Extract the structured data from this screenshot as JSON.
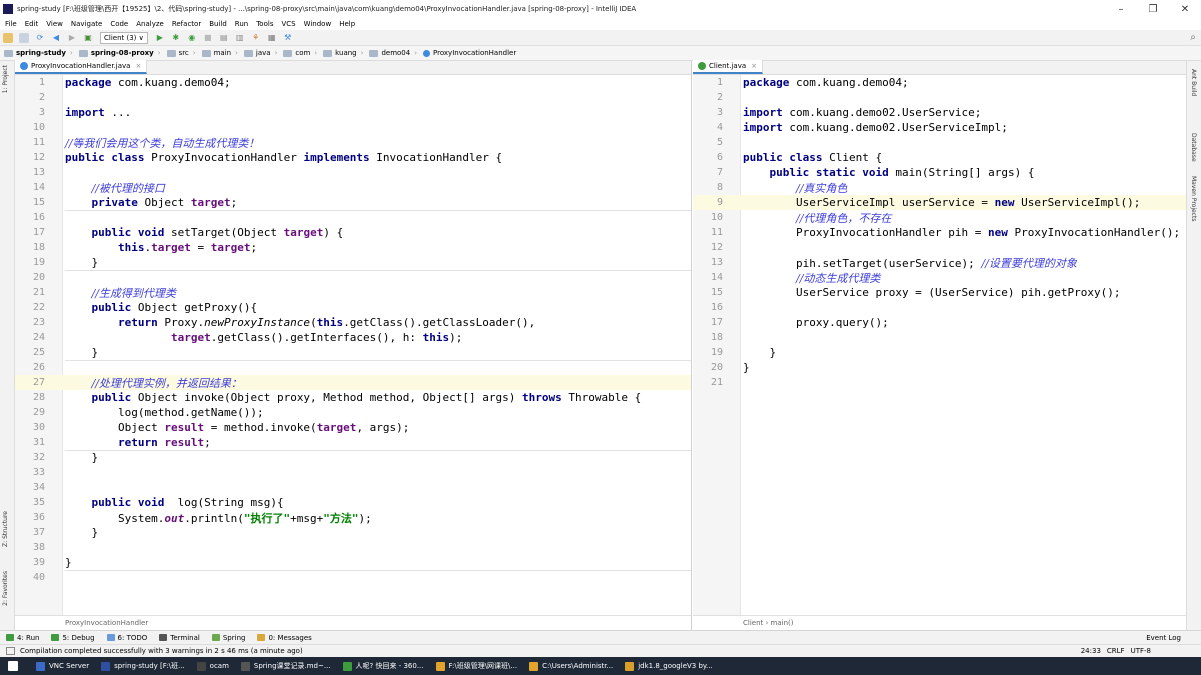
{
  "window": {
    "title": "spring-study [F:\\班级管理\\西开【19525】\\2、代码\\spring-study] - ...\\spring-08-proxy\\src\\main\\java\\com\\kuang\\demo04\\ProxyInvocationHandler.java [spring-08-proxy] - IntelliJ IDEA",
    "minimize": "–",
    "maximize": "❐",
    "close": "✕"
  },
  "menu": [
    "File",
    "Edit",
    "View",
    "Navigate",
    "Code",
    "Analyze",
    "Refactor",
    "Build",
    "Run",
    "Tools",
    "VCS",
    "Window",
    "Help"
  ],
  "toolbar": {
    "run_config": "Client (3) ∨"
  },
  "breadcrumb": [
    "spring-study",
    "spring-08-proxy",
    "src",
    "main",
    "java",
    "com",
    "kuang",
    "demo04",
    "ProxyInvocationHandler"
  ],
  "left_side_tabs": {
    "project": "1: Project",
    "structure": "Z: Structure",
    "favorites": "2: Favorites"
  },
  "right_side_tabs": {
    "ant": "Ant Build",
    "database": "Database",
    "maven": "Maven Projects"
  },
  "left_editor": {
    "tab": "ProxyInvocationHandler.java",
    "footer": "ProxyInvocationHandler",
    "lines": [
      {
        "n": "1",
        "t": "package com.kuang.demo04;"
      },
      {
        "n": "2",
        "t": ""
      },
      {
        "n": "3",
        "t": "import ..."
      },
      {
        "n": "10",
        "t": ""
      },
      {
        "n": "11",
        "t": "//等我们会用这个类，自动生成代理类！"
      },
      {
        "n": "12",
        "t": "public class ProxyInvocationHandler implements InvocationHandler {"
      },
      {
        "n": "13",
        "t": ""
      },
      {
        "n": "14",
        "t": "    //被代理的接口"
      },
      {
        "n": "15",
        "t": "    private Object target;"
      },
      {
        "n": "16",
        "t": ""
      },
      {
        "n": "17",
        "t": "    public void setTarget(Object target) {"
      },
      {
        "n": "18",
        "t": "        this.target = target;"
      },
      {
        "n": "19",
        "t": "    }"
      },
      {
        "n": "20",
        "t": ""
      },
      {
        "n": "21",
        "t": "    //生成得到代理类"
      },
      {
        "n": "22",
        "t": "    public Object getProxy(){"
      },
      {
        "n": "23",
        "t": "        return Proxy.newProxyInstance(this.getClass().getClassLoader(),"
      },
      {
        "n": "24",
        "t": "                target.getClass().getInterfaces(), h: this);"
      },
      {
        "n": "25",
        "t": "    }"
      },
      {
        "n": "26",
        "t": ""
      },
      {
        "n": "27",
        "t": "    //处理代理实例，并返回结果："
      },
      {
        "n": "28",
        "t": "    public Object invoke(Object proxy, Method method, Object[] args) throws Throwable {"
      },
      {
        "n": "29",
        "t": "        log(method.getName());"
      },
      {
        "n": "30",
        "t": "        Object result = method.invoke(target, args);"
      },
      {
        "n": "31",
        "t": "        return result;"
      },
      {
        "n": "32",
        "t": "    }"
      },
      {
        "n": "33",
        "t": ""
      },
      {
        "n": "34",
        "t": ""
      },
      {
        "n": "35",
        "t": "    public void  log(String msg){"
      },
      {
        "n": "36",
        "t": "        System.out.println(\"执行了\"+msg+\"方法\");"
      },
      {
        "n": "37",
        "t": "    }"
      },
      {
        "n": "38",
        "t": ""
      },
      {
        "n": "39",
        "t": "}"
      },
      {
        "n": "40",
        "t": ""
      }
    ]
  },
  "right_editor": {
    "tab": "Client.java",
    "footer": "Client  ›  main()",
    "lines": [
      {
        "n": "1",
        "t": "package com.kuang.demo04;"
      },
      {
        "n": "2",
        "t": ""
      },
      {
        "n": "3",
        "t": "import com.kuang.demo02.UserService;"
      },
      {
        "n": "4",
        "t": "import com.kuang.demo02.UserServiceImpl;"
      },
      {
        "n": "5",
        "t": ""
      },
      {
        "n": "6",
        "t": "public class Client {"
      },
      {
        "n": "7",
        "t": "    public static void main(String[] args) {"
      },
      {
        "n": "8",
        "t": "        //真实角色"
      },
      {
        "n": "9",
        "t": "        UserServiceImpl userService = new UserServiceImpl();"
      },
      {
        "n": "10",
        "t": "        //代理角色，不存在"
      },
      {
        "n": "11",
        "t": "        ProxyInvocationHandler pih = new ProxyInvocationHandler();"
      },
      {
        "n": "12",
        "t": ""
      },
      {
        "n": "13",
        "t": "        pih.setTarget(userService); //设置要代理的对象"
      },
      {
        "n": "14",
        "t": "        //动态生成代理类"
      },
      {
        "n": "15",
        "t": "        UserService proxy = (UserService) pih.getProxy();"
      },
      {
        "n": "16",
        "t": ""
      },
      {
        "n": "17",
        "t": "        proxy.query();"
      },
      {
        "n": "18",
        "t": ""
      },
      {
        "n": "19",
        "t": "    }"
      },
      {
        "n": "20",
        "t": "}"
      },
      {
        "n": "21",
        "t": ""
      }
    ]
  },
  "tool_windows": [
    "4: Run",
    "5: Debug",
    "6: TODO",
    "Terminal",
    "Spring",
    "0: Messages"
  ],
  "event_log": "Event Log",
  "status": {
    "message": "Compilation completed successfully with 3 warnings in 2 s 46 ms (a minute ago)",
    "position": "24:33",
    "line_sep": "CRLF",
    "encoding": "UTF-8"
  },
  "taskbar": [
    "VNC Server",
    "spring-study [F:\\班...",
    "ocam",
    "Spring课堂记录.md~...",
    "人呢? 快回来 - 360...",
    "F:\\班级管理\\网课班\\...",
    "C:\\Users\\Administr...",
    "jdk1.8_googleV3 by..."
  ],
  "colors": {
    "keyword": "#000080",
    "field": "#660e7a",
    "string": "#008000",
    "comment": "#3d3dd8",
    "accent": "#4083c9"
  }
}
